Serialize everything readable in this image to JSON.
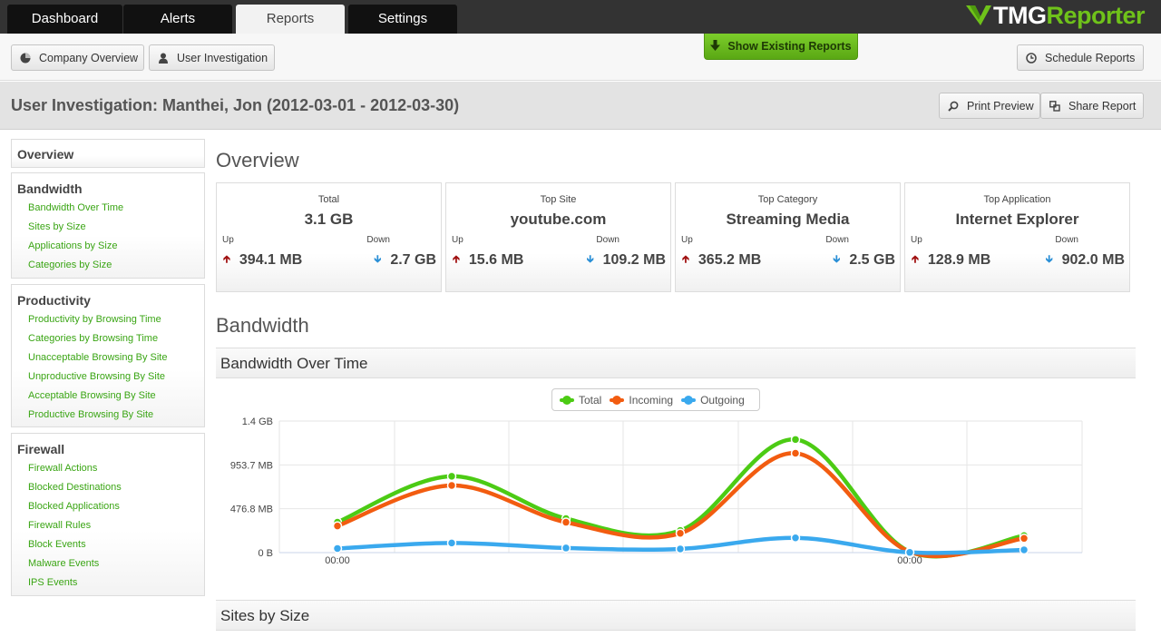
{
  "nav": {
    "tabs": [
      {
        "label": "Dashboard",
        "active": false
      },
      {
        "label": "Alerts",
        "active": false
      },
      {
        "label": "Reports",
        "active": true
      },
      {
        "label": "Settings",
        "active": false
      }
    ],
    "logo": {
      "part1": "TMG",
      "part2": "Reporter"
    }
  },
  "toolbar": {
    "company_overview": "Company Overview",
    "user_investigation": "User Investigation",
    "show_existing": "Show Existing Reports",
    "schedule": "Schedule Reports"
  },
  "titlebar": {
    "title": "User Investigation: Manthei, Jon (2012-03-01 - 2012-03-30)",
    "print": "Print Preview",
    "share": "Share Report"
  },
  "sidebar": {
    "overview": "Overview",
    "bandwidth": {
      "title": "Bandwidth",
      "items": [
        "Bandwidth Over Time",
        "Sites by Size",
        "Applications by Size",
        "Categories by Size"
      ]
    },
    "productivity": {
      "title": "Productivity",
      "items": [
        "Productivity by Browsing Time",
        "Categories by Browsing Time",
        "Unacceptable Browsing By Site",
        "Unproductive Browsing By Site",
        "Acceptable Browsing By Site",
        "Productive Browsing By Site"
      ]
    },
    "firewall": {
      "title": "Firewall",
      "items": [
        "Firewall Actions",
        "Blocked Destinations",
        "Blocked Applications",
        "Firewall Rules",
        "Block Events",
        "Malware Events",
        "IPS Events"
      ]
    }
  },
  "main": {
    "overview_heading": "Overview",
    "up_label": "Up",
    "down_label": "Down",
    "cards": [
      {
        "label": "Total",
        "value": "3.1 GB",
        "up": "394.1 MB",
        "down": "2.7 GB"
      },
      {
        "label": "Top Site",
        "value": "youtube.com",
        "up": "15.6 MB",
        "down": "109.2 MB"
      },
      {
        "label": "Top Category",
        "value": "Streaming Media",
        "up": "365.2 MB",
        "down": "2.5 GB"
      },
      {
        "label": "Top Application",
        "value": "Internet Explorer",
        "up": "128.9 MB",
        "down": "902.0 MB"
      }
    ],
    "bandwidth_heading": "Bandwidth",
    "bandwidth_over_time": "Bandwidth Over Time",
    "sites_by_size": "Sites by Size"
  },
  "colors": {
    "total": "#4ccb14",
    "incoming": "#f25c10",
    "outgoing": "#3aa9ee",
    "link": "#3aa514",
    "accent": "#6fc21a"
  },
  "chart_data": {
    "type": "line",
    "x": [
      0,
      1,
      2,
      3,
      4,
      5,
      6
    ],
    "x_tick_labels": [
      "00:00",
      "00:00"
    ],
    "y_tick_labels": [
      "1.4 GB",
      "953.7 MB",
      "476.8 MB",
      "0 B"
    ],
    "y_ticks_mb": [
      1430.5,
      953.7,
      476.8,
      0
    ],
    "ylim_mb": [
      0,
      1430.5
    ],
    "grid": true,
    "legend": "top-center",
    "series": [
      {
        "name": "Total",
        "values_mb": [
          330,
          830,
          370,
          240,
          1230,
          10,
          185
        ]
      },
      {
        "name": "Incoming",
        "values_mb": [
          290,
          730,
          330,
          210,
          1080,
          8,
          155
        ]
      },
      {
        "name": "Outgoing",
        "values_mb": [
          45,
          105,
          50,
          40,
          160,
          2,
          30
        ]
      }
    ]
  }
}
